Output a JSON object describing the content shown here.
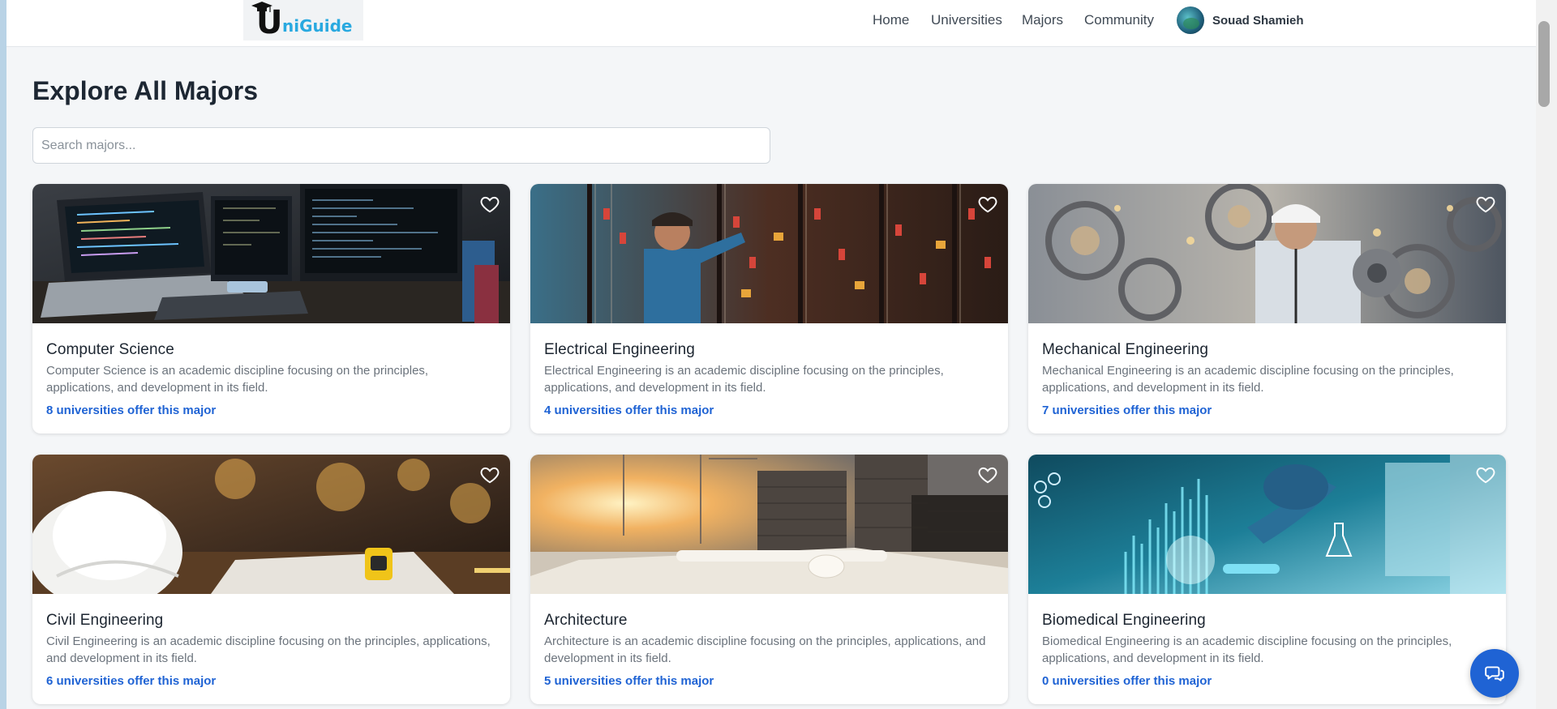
{
  "brand": {
    "logo_letter": "U",
    "logo_rest": "niGuide"
  },
  "nav": {
    "home": "Home",
    "universities": "Universities",
    "majors": "Majors",
    "community": "Community",
    "user_name": "Souad Shamieh"
  },
  "page": {
    "title": "Explore All Majors"
  },
  "search": {
    "placeholder": "Search majors..."
  },
  "majors": [
    {
      "name": "Computer Science",
      "description": "Computer Science is an academic discipline focusing on the principles, applications, and development in its field.",
      "universities": "8 universities offer this major"
    },
    {
      "name": "Electrical Engineering",
      "description": "Electrical Engineering is an academic discipline focusing on the principles, applications, and development in its field.",
      "universities": "4 universities offer this major"
    },
    {
      "name": "Mechanical Engineering",
      "description": "Mechanical Engineering is an academic discipline focusing on the principles, applications, and development in its field.",
      "universities": "7 universities offer this major"
    },
    {
      "name": "Civil Engineering",
      "description": "Civil Engineering is an academic discipline focusing on the principles, applications, and development in its field.",
      "universities": "6 universities offer this major"
    },
    {
      "name": "Architecture",
      "description": "Architecture is an academic discipline focusing on the principles, applications, and development in its field.",
      "universities": "5 universities offer this major"
    },
    {
      "name": "Biomedical Engineering",
      "description": "Biomedical Engineering is an academic discipline focusing on the principles, applications, and development in its field.",
      "universities": "0 universities offer this major"
    }
  ],
  "colors": {
    "accent": "#1f63d4",
    "logo_blue": "#29a9e0",
    "background": "#f4f6f8"
  },
  "icons": {
    "favorite": "heart-outline-icon",
    "chat": "chat-bubbles-icon",
    "logo_cap": "graduation-cap-icon"
  }
}
